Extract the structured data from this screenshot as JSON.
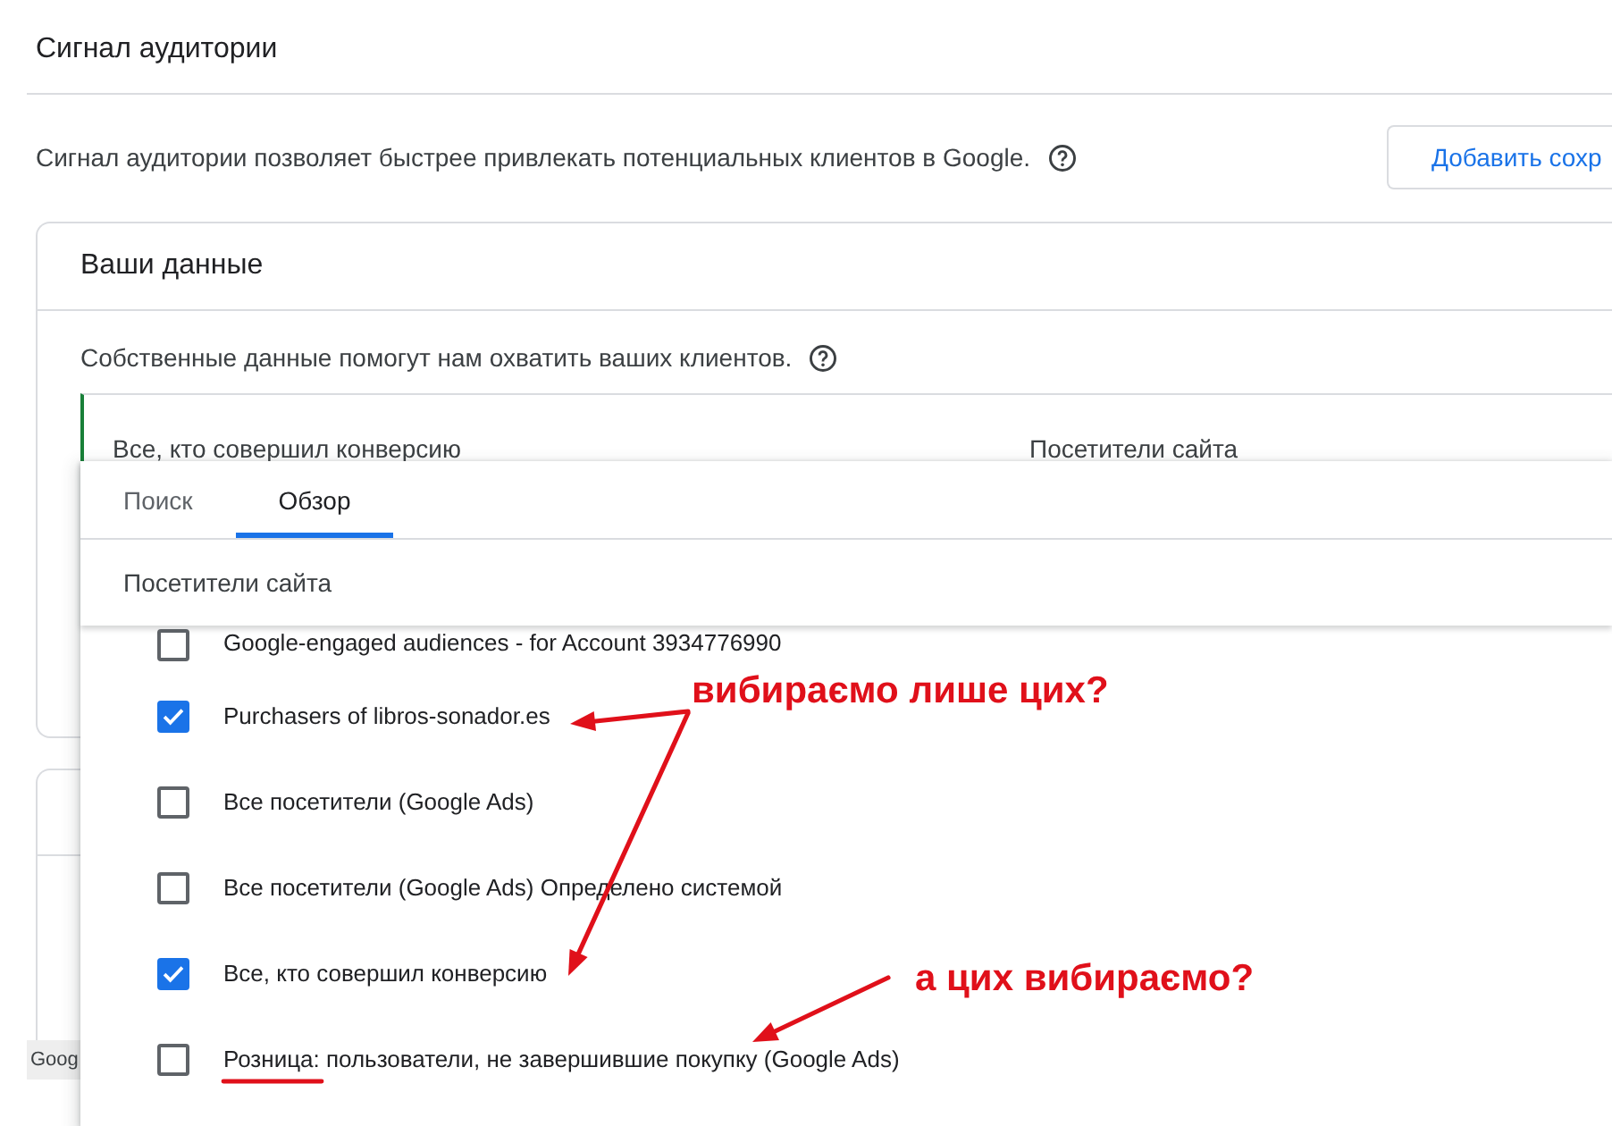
{
  "section": {
    "title": "Сигнал аудитории",
    "description": "Сигнал аудитории позволяет быстрее привлекать потенциальных клиентов в Google.",
    "button": "Добавить сохр"
  },
  "your_data": {
    "title": "Ваши данные",
    "description": "Собственные данные помогут нам охватить ваших клиентов.",
    "segment": {
      "cells": [
        "Все, кто совершил конверсию",
        "Посетители сайта"
      ]
    }
  },
  "status_bubble": {
    "text": "Goog"
  },
  "picker": {
    "tabs": [
      {
        "label": "Поиск",
        "selected": false
      },
      {
        "label": "Обзор",
        "selected": true
      }
    ],
    "breadcrumb": "Посетители сайта",
    "items": [
      {
        "label": "Google-engaged audiences - for Account 3934776990",
        "checked": false
      },
      {
        "label": "Purchasers of libros-sonador.es",
        "checked": true
      },
      {
        "label": "Все посетители (Google Ads)",
        "checked": false
      },
      {
        "label": "Все посетители (Google Ads) Определено системой",
        "checked": false
      },
      {
        "label": "Все, кто совершил конверсию",
        "checked": true
      },
      {
        "label": "Розница: пользователи, не завершившие покупку (Google Ads)",
        "checked": false
      }
    ]
  },
  "annotations": [
    {
      "text": "вибираємо лише цих?"
    },
    {
      "text": "а цих вибираємо?"
    }
  ]
}
